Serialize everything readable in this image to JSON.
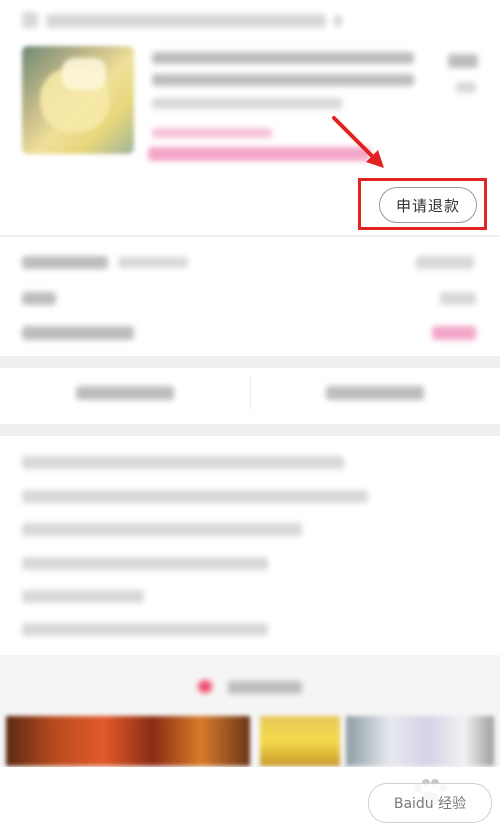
{
  "order": {
    "refund_button_label": "申请退款"
  },
  "watermark": {
    "text": "Baidu 经验"
  },
  "colors": {
    "highlight": "#e32222",
    "price_pink": "#f3a6c8"
  }
}
